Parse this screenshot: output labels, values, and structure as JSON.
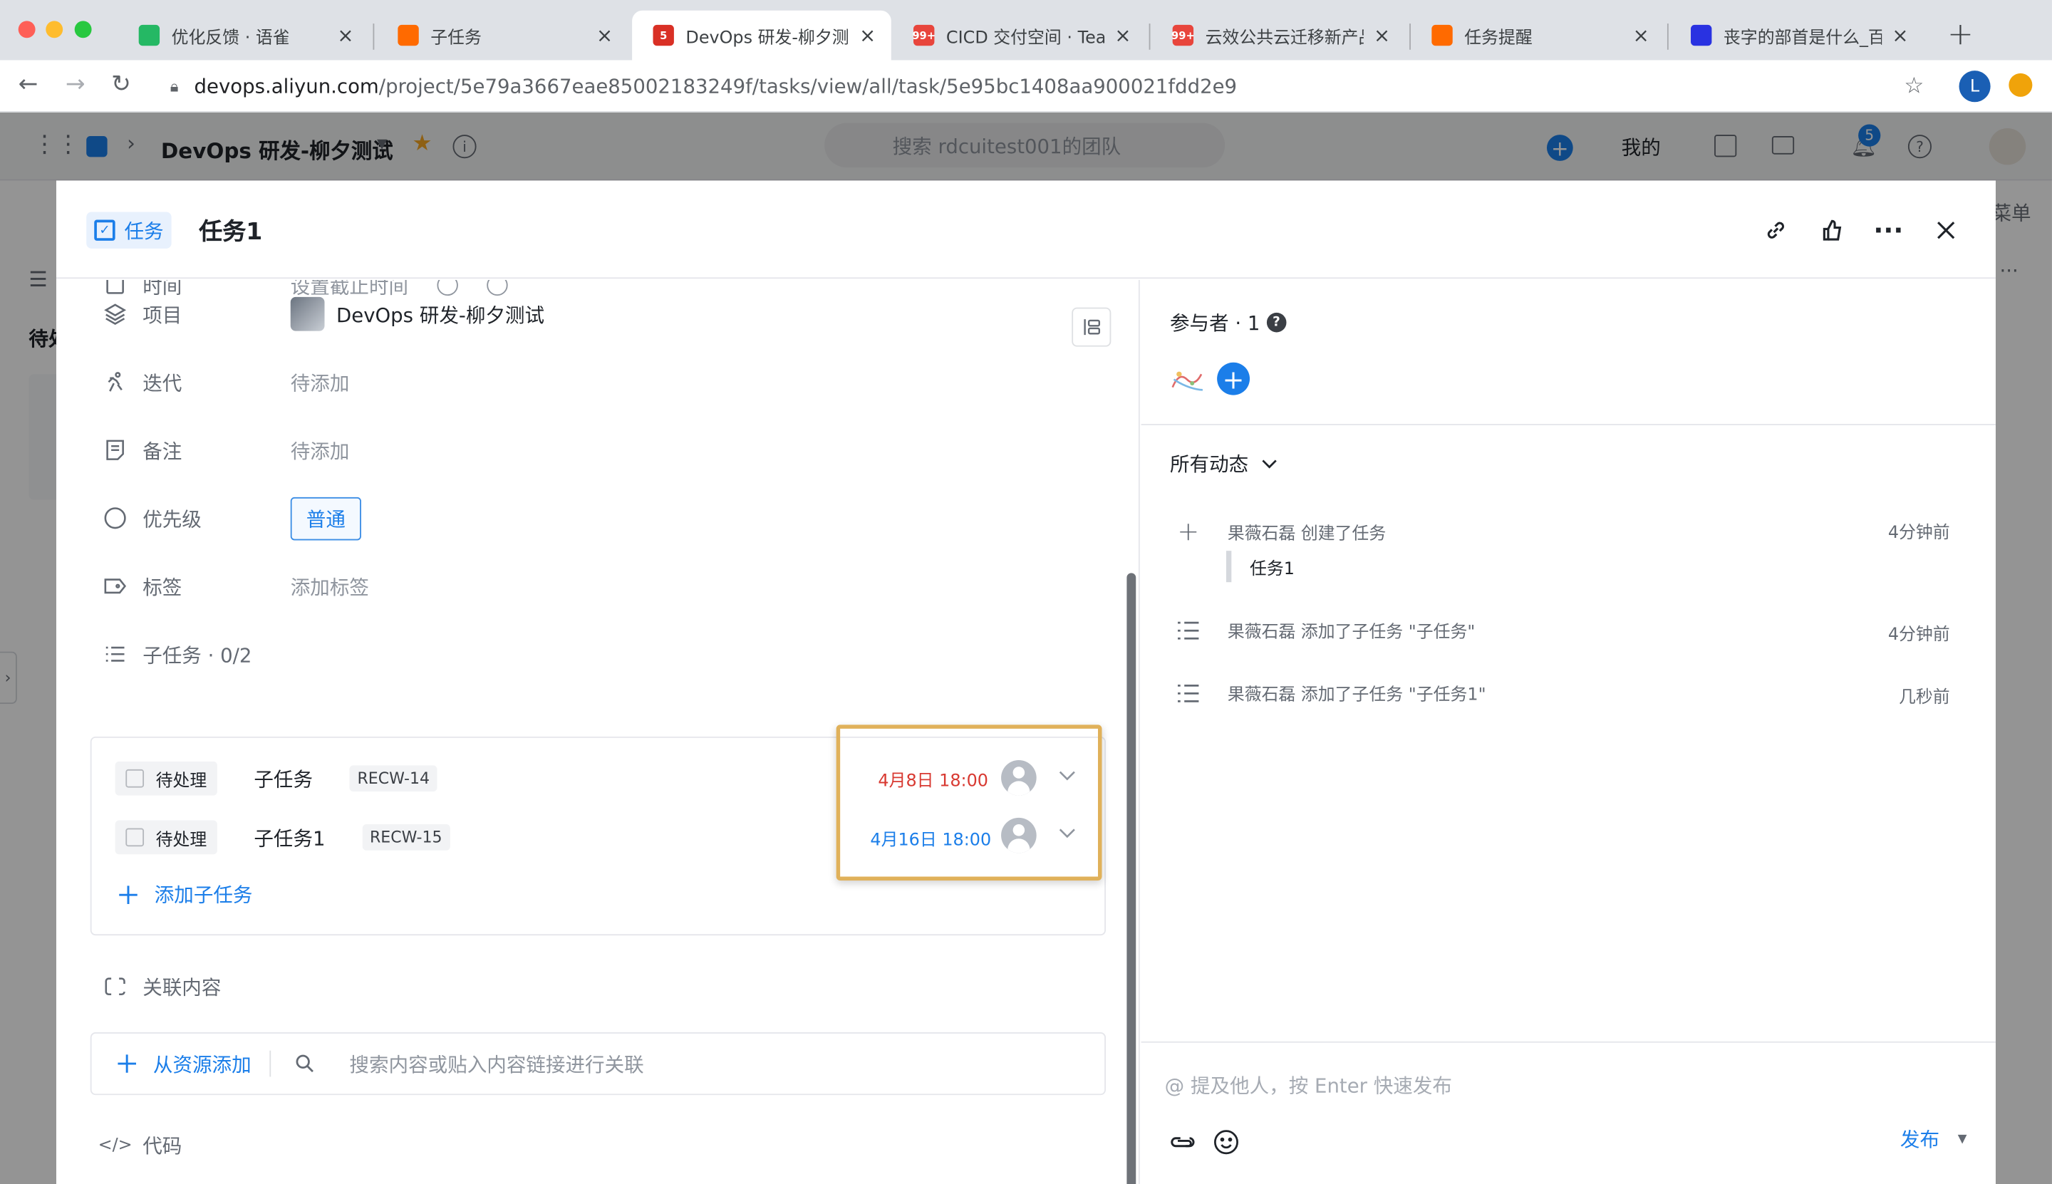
{
  "browser": {
    "tabs": [
      {
        "title": "优化反馈 · 语雀",
        "icon": "yuque-icon",
        "color": "#25b864"
      },
      {
        "title": "子任务",
        "icon": "aliyun-icon",
        "color": "#ff6a00"
      },
      {
        "title": "DevOps 研发-柳夕测试",
        "icon": "devops-icon",
        "color": "#d93025",
        "badge": "5"
      },
      {
        "title": "CICD 交付空间 · Teambition",
        "icon": "teambition-icon",
        "color": "#e8453c",
        "badge": "99+"
      },
      {
        "title": "云效公共云迁移新产品",
        "icon": "teambition-icon",
        "color": "#e8453c",
        "badge": "99+"
      },
      {
        "title": "任务提醒",
        "icon": "aliyun-icon",
        "color": "#ff6a00"
      },
      {
        "title": "丧字的部首是什么_百度",
        "icon": "baidu-icon",
        "color": "#2932e1"
      }
    ],
    "url_host": "devops.aliyun.com",
    "url_path": "/project/5e79a3667eae85002183249f/tasks/view/all/task/5e95bc1408aa900021fdd2e9",
    "profile_initial": "L"
  },
  "app": {
    "project_name": "DevOps 研发-柳夕测试",
    "search_placeholder": "搜索 rdcuitest001的团队",
    "mine_label": "我的",
    "notification_count": "5",
    "behind_label_left": "待处",
    "behind_label_right": "菜单"
  },
  "task": {
    "type_label": "任务",
    "title": "任务1",
    "fields": {
      "time_label": "时间",
      "time_value": "设置截止时间",
      "project_label": "项目",
      "project_value": "DevOps 研发-柳夕测试",
      "iteration_label": "迭代",
      "iteration_value": "待添加",
      "note_label": "备注",
      "note_value": "待添加",
      "priority_label": "优先级",
      "priority_value": "普通",
      "tags_label": "标签",
      "tags_value": "添加标签",
      "subtasks_label": "子任务 · 0/2"
    },
    "subtasks": [
      {
        "status": "待处理",
        "name": "子任务",
        "code": "RECW-14",
        "due": "4月8日 18:00",
        "due_color": "#d83931"
      },
      {
        "status": "待处理",
        "name": "子任务1",
        "code": "RECW-15",
        "due": "4月16日 18:00",
        "due_color": "#1b7ee9"
      }
    ],
    "add_subtask_label": "添加子任务",
    "related_label": "关联内容",
    "add_from_resource_label": "从资源添加",
    "related_search_placeholder": "搜索内容或贴入内容链接进行关联",
    "code_label": "代码"
  },
  "sidebar": {
    "participants_label": "参与者 · 1",
    "activity_filter": "所有动态",
    "activities": [
      {
        "text": "果薇石磊 创建了任务",
        "time": "4分钟前",
        "quote": "任务1"
      },
      {
        "text": "果薇石磊 添加了子任务 \"子任务\"",
        "time": "4分钟前"
      },
      {
        "text": "果薇石磊 添加了子任务 \"子任务1\"",
        "time": "几秒前"
      }
    ],
    "comment_placeholder": "@ 提及他人，按 Enter 快速发布",
    "publish_label": "发布"
  }
}
